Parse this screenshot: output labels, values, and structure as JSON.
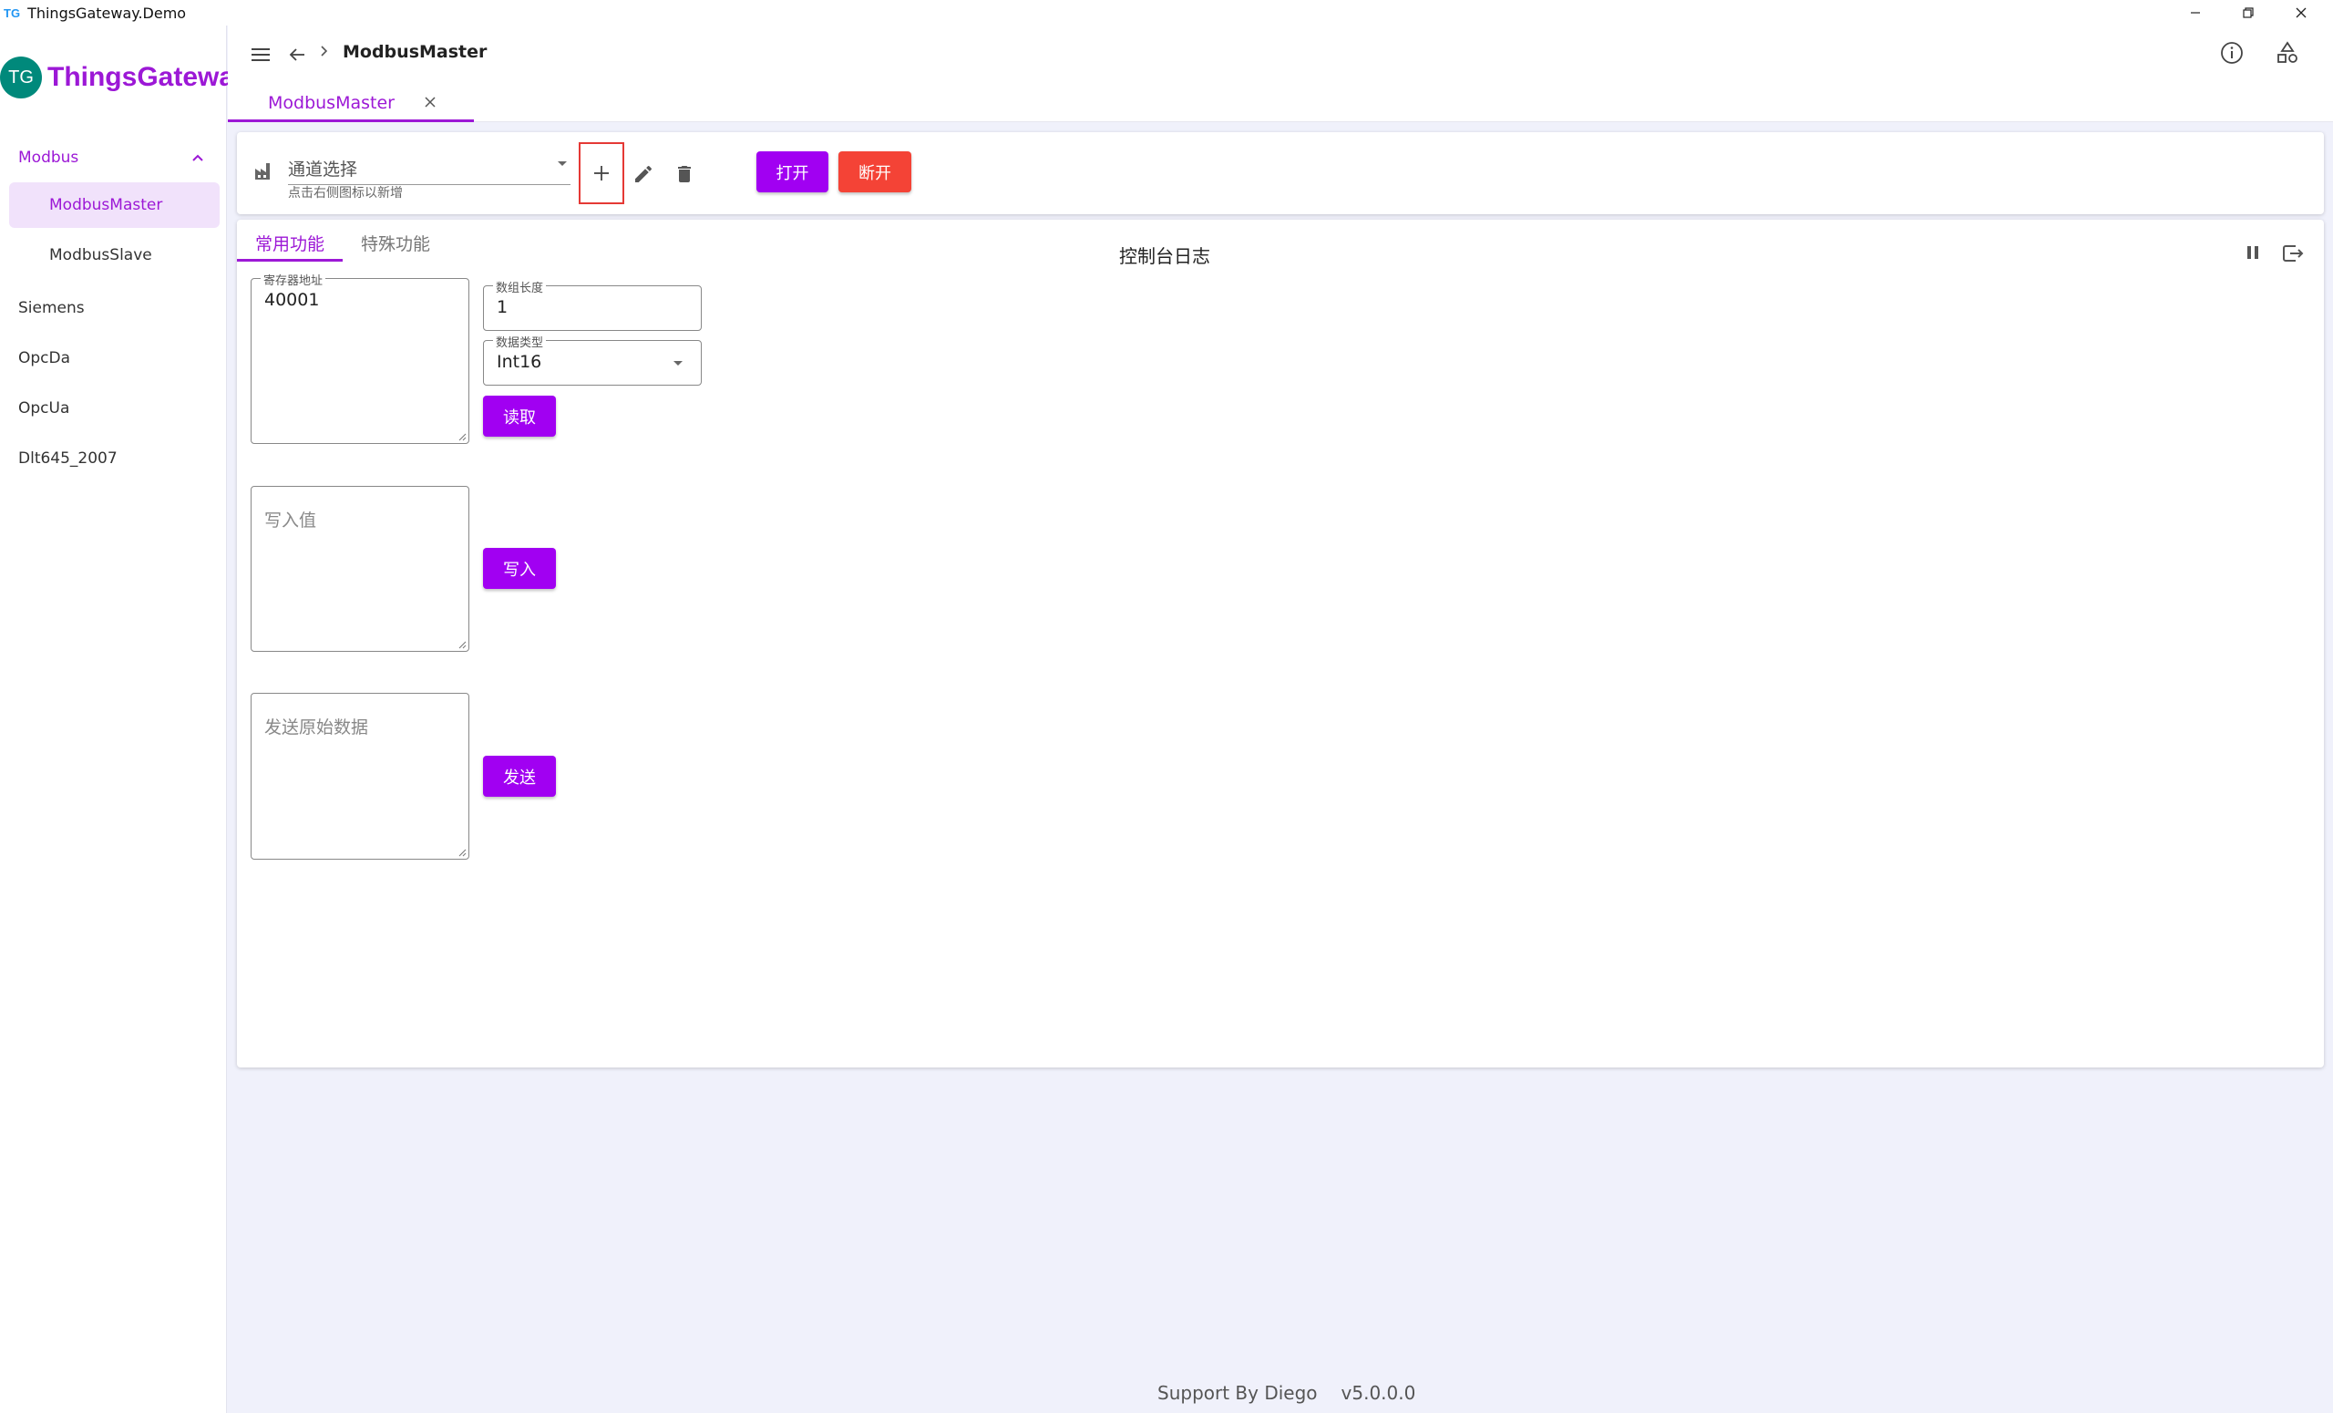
{
  "window": {
    "icon_text": "TG",
    "title": "ThingsGateway.Demo"
  },
  "brand": {
    "logo_text": "TG",
    "name": "ThingsGateway"
  },
  "sidebar": {
    "groups": [
      {
        "label": "Modbus",
        "expanded": true,
        "children": [
          {
            "label": "ModbusMaster",
            "active": true
          },
          {
            "label": "ModbusSlave",
            "active": false
          }
        ]
      }
    ],
    "items": [
      {
        "label": "Siemens"
      },
      {
        "label": "OpcDa"
      },
      {
        "label": "OpcUa"
      },
      {
        "label": "Dlt645_2007"
      }
    ]
  },
  "header": {
    "breadcrumb": "ModbusMaster",
    "tab": "ModbusMaster"
  },
  "toolbar": {
    "channel_placeholder": "通道选择",
    "channel_hint": "点击右侧图标以新增",
    "open_label": "打开",
    "disconnect_label": "断开"
  },
  "main": {
    "tabs": [
      {
        "label": "常用功能",
        "active": true
      },
      {
        "label": "特殊功能",
        "active": false
      }
    ],
    "console_title": "控制台日志",
    "register_address": {
      "legend": "寄存器地址",
      "value": "40001"
    },
    "array_length": {
      "legend": "数组长度",
      "value": "1"
    },
    "data_type": {
      "legend": "数据类型",
      "value": "Int16"
    },
    "read_label": "读取",
    "write_value_placeholder": "写入值",
    "write_label": "写入",
    "raw_data_placeholder": "发送原始数据",
    "send_label": "发送"
  },
  "footer": {
    "support": "Support By Diego",
    "version": "v5.0.0.0"
  },
  "colors": {
    "accent": "#9c18d6",
    "button_purple": "#a100f2",
    "button_red": "#f44336",
    "logo_bg": "#00897b",
    "highlight_box": "#e53935"
  }
}
